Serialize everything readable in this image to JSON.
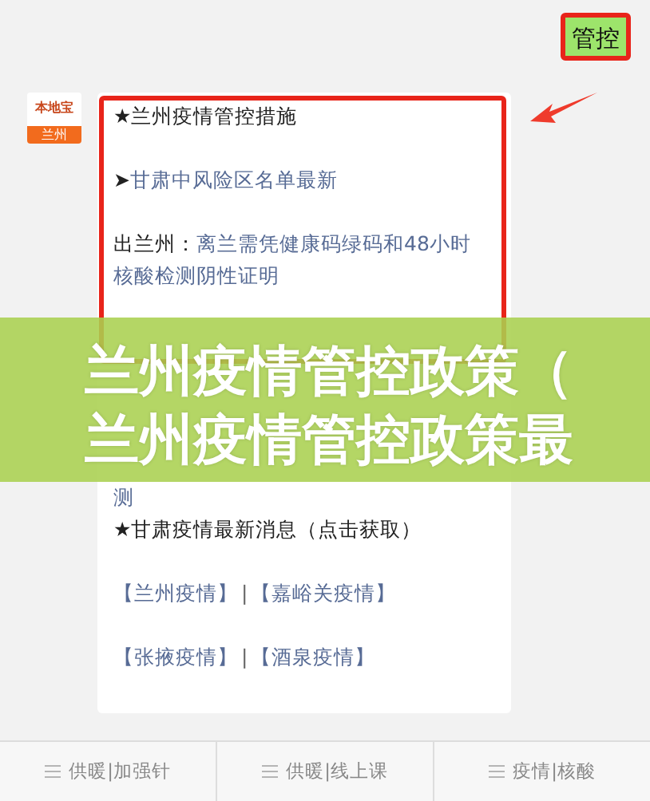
{
  "sent_message": {
    "text": "管控",
    "highlighted": true
  },
  "sender": {
    "logo_text": "本地宝",
    "city": "兰州"
  },
  "message": {
    "highlighted": true,
    "items": [
      {
        "kind": "heading",
        "text": "★兰州疫情管控措施"
      },
      {
        "kind": "link",
        "marker": "➤",
        "text": "甘肃中风险区名单最新"
      },
      {
        "kind": "labeled",
        "label": "出兰州：",
        "text": "离兰需凭健康码绿码和48小时核酸检测阴性证明"
      },
      {
        "kind": "continuation",
        "text": "测"
      },
      {
        "kind": "heading",
        "text": "★甘肃疫情最新消息（点击获取）"
      },
      {
        "kind": "links",
        "links": [
          "【兰州疫情】",
          "【嘉峪关疫情】"
        ],
        "separator": "|"
      },
      {
        "kind": "links",
        "links": [
          "【张掖疫情】",
          "【酒泉疫情】"
        ],
        "separator": "|"
      }
    ]
  },
  "banner": {
    "lines": [
      "兰州疫情管控政策（",
      "兰州疫情管控政策最"
    ]
  },
  "menu": [
    {
      "label": "供暖|加强针"
    },
    {
      "label": "供暖|线上课"
    },
    {
      "label": "疫情|核酸"
    }
  ]
}
